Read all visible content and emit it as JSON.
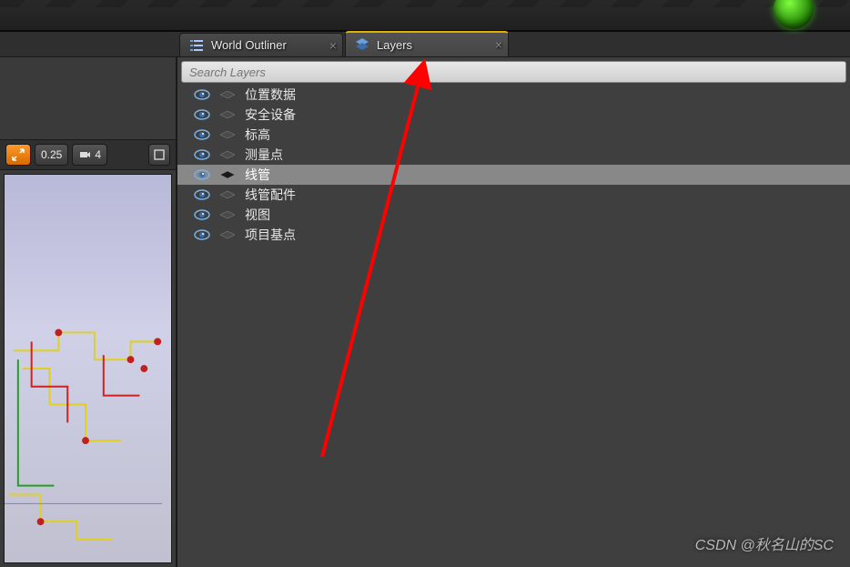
{
  "tabs": {
    "world_outliner": "World Outliner",
    "layers": "Layers"
  },
  "viewport_toolbar": {
    "snap_value": "0.25",
    "camera_speed": "4"
  },
  "search": {
    "placeholder": "Search Layers"
  },
  "layers": [
    {
      "name": "位置数据",
      "visible": true,
      "selected": false
    },
    {
      "name": "安全设备",
      "visible": true,
      "selected": false
    },
    {
      "name": "标高",
      "visible": true,
      "selected": false
    },
    {
      "name": "测量点",
      "visible": true,
      "selected": false
    },
    {
      "name": "线管",
      "visible": true,
      "selected": true
    },
    {
      "name": "线管配件",
      "visible": true,
      "selected": false
    },
    {
      "name": "视图",
      "visible": true,
      "selected": false
    },
    {
      "name": "项目基点",
      "visible": true,
      "selected": false
    }
  ],
  "watermark": "CSDN @秋名山的SC"
}
